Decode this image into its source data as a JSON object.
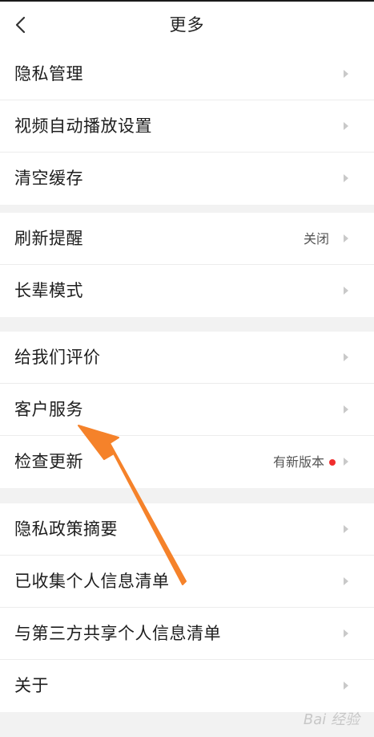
{
  "header": {
    "title": "更多",
    "back_icon": "chevron-left-icon"
  },
  "groups": [
    {
      "items": [
        {
          "label": "隐私管理"
        },
        {
          "label": "视频自动播放设置"
        },
        {
          "label": "清空缓存"
        }
      ]
    },
    {
      "items": [
        {
          "label": "刷新提醒",
          "value": "关闭"
        },
        {
          "label": "长辈模式"
        }
      ]
    },
    {
      "items": [
        {
          "label": "给我们评价"
        },
        {
          "label": "客户服务"
        },
        {
          "label": "检查更新",
          "value": "有新版本",
          "badge_color": "#f02d2d"
        }
      ]
    },
    {
      "items": [
        {
          "label": "隐私政策摘要"
        },
        {
          "label": "已收集个人信息清单"
        },
        {
          "label": "与第三方共享个人信息清单"
        },
        {
          "label": "关于"
        }
      ]
    }
  ],
  "annotation": {
    "arrow_color": "#f5822a"
  },
  "watermark": "Bai 经验"
}
